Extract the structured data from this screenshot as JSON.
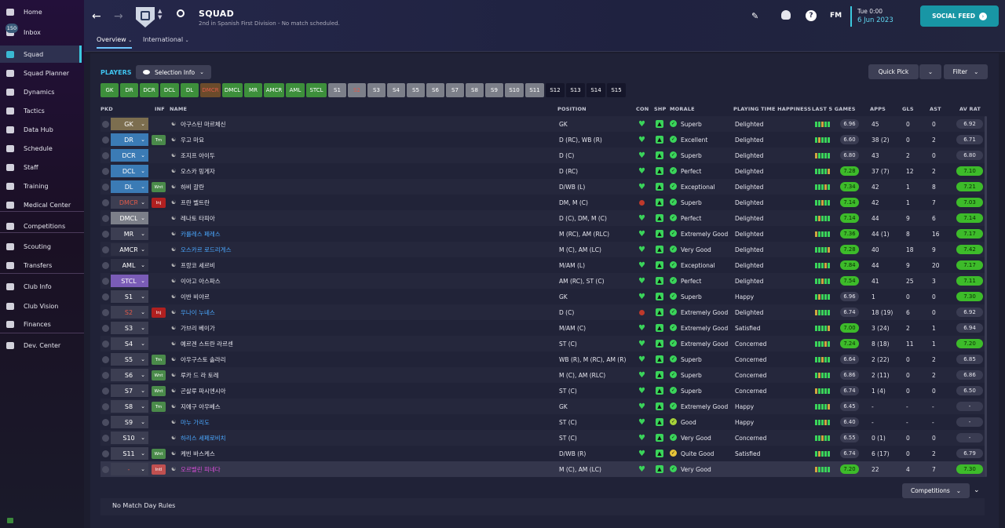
{
  "sidebar": {
    "inbox_badge": "150",
    "items": [
      {
        "label": "Home",
        "icon": "home-icon"
      },
      {
        "label": "Inbox",
        "icon": "inbox-icon"
      },
      {
        "label": "Squad",
        "icon": "shirt-icon"
      },
      {
        "label": "Squad Planner",
        "icon": "clipboard-icon"
      },
      {
        "label": "Dynamics",
        "icon": "dynamics-icon"
      },
      {
        "label": "Tactics",
        "icon": "tactics-icon"
      },
      {
        "label": "Data Hub",
        "icon": "data-hub-icon"
      },
      {
        "label": "Schedule",
        "icon": "calendar-icon"
      },
      {
        "label": "Staff",
        "icon": "staff-icon"
      },
      {
        "label": "Training",
        "icon": "training-icon"
      },
      {
        "label": "Medical Center",
        "icon": "medical-icon"
      },
      {
        "label": "Competitions",
        "icon": "trophy-icon"
      },
      {
        "label": "Scouting",
        "icon": "scouting-icon"
      },
      {
        "label": "Transfers",
        "icon": "transfers-icon"
      },
      {
        "label": "Club Info",
        "icon": "shield-icon"
      },
      {
        "label": "Club Vision",
        "icon": "vision-icon"
      },
      {
        "label": "Finances",
        "icon": "finances-icon"
      },
      {
        "label": "Dev. Center",
        "icon": "dev-center-icon"
      }
    ]
  },
  "header": {
    "title": "SQUAD",
    "subtitle": "2nd in Spanish First Division - No match scheduled.",
    "tabs": [
      "Overview",
      "International"
    ],
    "fm": "FM",
    "time": "Tue 0:00",
    "date": "6 Jun 2023",
    "social_feed": "SOCIAL FEED"
  },
  "players_title": "PLAYERS",
  "selection_info": "Selection Info",
  "quick_pick": "Quick Pick",
  "filter": "Filter",
  "formation_slots": [
    "GK",
    "DR",
    "DCR",
    "DCL",
    "DL",
    "DMCR",
    "DMCL",
    "MR",
    "AMCR",
    "AML",
    "STCL",
    "S1",
    "S2",
    "S3",
    "S4",
    "S5",
    "S6",
    "S7",
    "S8",
    "S9",
    "S10",
    "S11",
    "S12",
    "S13",
    "S14",
    "S15"
  ],
  "columns": {
    "pkd": "PKD",
    "inf": "INF",
    "name": "NAME",
    "position": "POSITION",
    "con": "CON",
    "shp": "SHP",
    "morale": "MORALE",
    "pth": "PLAYING TIME HAPPINESS",
    "last5": "LAST 5 GAMES",
    "apps": "APPS",
    "gls": "GLS",
    "ast": "AST",
    "avrat": "AV RAT"
  },
  "players": [
    {
      "slot": "GK",
      "inf": "",
      "name": "아구스틴 마르체신",
      "pos": "GK",
      "con": "fit",
      "morale": "Superb",
      "pt": "Delighted",
      "l5": "6.96",
      "apps": "45",
      "gls": "0",
      "ast": "0",
      "av": "6.92"
    },
    {
      "slot": "DR",
      "inf": "Trn",
      "name": "우고 마요",
      "pos": "D (RC), WB (R)",
      "con": "fit",
      "morale": "Excellent",
      "pt": "Delighted",
      "l5": "6.60",
      "apps": "38 (2)",
      "gls": "0",
      "ast": "2",
      "av": "6.71"
    },
    {
      "slot": "DCR",
      "inf": "",
      "name": "조지프 아이두",
      "pos": "D (C)",
      "con": "fit",
      "morale": "Superb",
      "pt": "Delighted",
      "l5": "6.80",
      "apps": "43",
      "gls": "2",
      "ast": "0",
      "av": "6.80"
    },
    {
      "slot": "DCL",
      "inf": "",
      "name": "오스카 밍게자",
      "pos": "D (RC)",
      "con": "fit",
      "morale": "Perfect",
      "pt": "Delighted",
      "l5": "7.28",
      "apps": "37 (7)",
      "gls": "12",
      "ast": "2",
      "av": "7.10"
    },
    {
      "slot": "DL",
      "inf": "Wnt",
      "name": "하비 갈란",
      "pos": "D/WB (L)",
      "con": "fit",
      "morale": "Exceptional",
      "pt": "Delighted",
      "l5": "7.34",
      "apps": "42",
      "gls": "1",
      "ast": "8",
      "av": "7.21"
    },
    {
      "slot": "DMCR",
      "inf": "Inj",
      "name": "프란 벨트란",
      "pos": "DM, M (C)",
      "con": "inj",
      "morale": "Superb",
      "pt": "Delighted",
      "l5": "7.14",
      "apps": "42",
      "gls": "1",
      "ast": "7",
      "av": "7.03"
    },
    {
      "slot": "DMCL",
      "inf": "",
      "name": "레나토 타피아",
      "pos": "D (C), DM, M (C)",
      "con": "fit",
      "morale": "Perfect",
      "pt": "Delighted",
      "l5": "7.14",
      "apps": "44",
      "gls": "9",
      "ast": "6",
      "av": "7.14"
    },
    {
      "slot": "MR",
      "inf": "",
      "name": "카를레스 페레스",
      "pos": "M (RC), AM (RLC)",
      "con": "fit",
      "morale": "Extremely Good",
      "pt": "Delighted",
      "l5": "7.36",
      "apps": "44 (1)",
      "gls": "8",
      "ast": "16",
      "av": "7.17"
    },
    {
      "slot": "AMCR",
      "inf": "",
      "name": "오스카르 로드리게스",
      "pos": "M (C), AM (LC)",
      "con": "fit",
      "morale": "Very Good",
      "pt": "Delighted",
      "l5": "7.28",
      "apps": "40",
      "gls": "18",
      "ast": "9",
      "av": "7.42"
    },
    {
      "slot": "AML",
      "inf": "",
      "name": "프랑코 세르비",
      "pos": "M/AM (L)",
      "con": "fit",
      "morale": "Exceptional",
      "pt": "Delighted",
      "l5": "7.84",
      "apps": "44",
      "gls": "9",
      "ast": "20",
      "av": "7.17"
    },
    {
      "slot": "STCL",
      "inf": "",
      "name": "이아고 아스파스",
      "pos": "AM (RC), ST (C)",
      "con": "fit",
      "morale": "Perfect",
      "pt": "Delighted",
      "l5": "7.54",
      "apps": "41",
      "gls": "25",
      "ast": "3",
      "av": "7.11"
    },
    {
      "slot": "S1",
      "inf": "",
      "name": "이반 비야르",
      "pos": "GK",
      "con": "fit",
      "morale": "Superb",
      "pt": "Happy",
      "l5": "6.96",
      "apps": "1",
      "gls": "0",
      "ast": "0",
      "av": "7.30"
    },
    {
      "slot": "S2",
      "inf": "Inj",
      "name": "우나이 누녜스",
      "pos": "D (C)",
      "con": "inj",
      "morale": "Extremely Good",
      "pt": "Delighted",
      "l5": "6.74",
      "apps": "18 (19)",
      "gls": "6",
      "ast": "0",
      "av": "6.92"
    },
    {
      "slot": "S3",
      "inf": "",
      "name": "가브리 베이가",
      "pos": "M/AM (C)",
      "con": "fit",
      "morale": "Extremely Good",
      "pt": "Satisfied",
      "l5": "7.00",
      "apps": "3 (24)",
      "gls": "2",
      "ast": "1",
      "av": "6.94"
    },
    {
      "slot": "S4",
      "inf": "",
      "name": "예르겐 스트란 라르센",
      "pos": "ST (C)",
      "con": "fit",
      "morale": "Extremely Good",
      "pt": "Concerned",
      "l5": "7.24",
      "apps": "8 (18)",
      "gls": "11",
      "ast": "1",
      "av": "7.20"
    },
    {
      "slot": "S5",
      "inf": "Trn",
      "name": "아우구스토 솔라리",
      "pos": "WB (R), M (RC), AM (R)",
      "con": "fit",
      "morale": "Superb",
      "pt": "Concerned",
      "l5": "6.64",
      "apps": "2 (22)",
      "gls": "0",
      "ast": "2",
      "av": "6.85"
    },
    {
      "slot": "S6",
      "inf": "Wnt",
      "name": "루카 드 라 토레",
      "pos": "M (C), AM (RLC)",
      "con": "fit",
      "morale": "Superb",
      "pt": "Concerned",
      "l5": "6.86",
      "apps": "2 (11)",
      "gls": "0",
      "ast": "2",
      "av": "6.86"
    },
    {
      "slot": "S7",
      "inf": "Wnt",
      "name": "곤살루 파시엔시아",
      "pos": "ST (C)",
      "con": "fit",
      "morale": "Superb",
      "pt": "Concerned",
      "l5": "6.74",
      "apps": "1 (4)",
      "gls": "0",
      "ast": "0",
      "av": "6.50"
    },
    {
      "slot": "S8",
      "inf": "Trn",
      "name": "지에구 아우베스",
      "pos": "GK",
      "con": "fit",
      "morale": "Extremely Good",
      "pt": "Happy",
      "l5": "6.45",
      "apps": "-",
      "gls": "-",
      "ast": "-",
      "av": "-"
    },
    {
      "slot": "S9",
      "inf": "",
      "name": "마누 가리도",
      "pos": "ST (C)",
      "con": "fit",
      "morale": "Good",
      "pt": "Happy",
      "l5": "6.40",
      "apps": "-",
      "gls": "-",
      "ast": "-",
      "av": "-"
    },
    {
      "slot": "S10",
      "inf": "",
      "name": "하리스 세페로비치",
      "pos": "ST (C)",
      "con": "fit",
      "morale": "Very Good",
      "pt": "Concerned",
      "l5": "6.55",
      "apps": "0 (1)",
      "gls": "0",
      "ast": "0",
      "av": "-"
    },
    {
      "slot": "S11",
      "inf": "Wnt",
      "name": "케빈 바스케스",
      "pos": "D/WB (R)",
      "con": "fit",
      "morale": "Quite Good",
      "pt": "Satisfied",
      "l5": "6.74",
      "apps": "6 (17)",
      "gls": "0",
      "ast": "2",
      "av": "6.79"
    },
    {
      "slot": "-",
      "inf": "Intl",
      "name": "오르벨린 피네다",
      "pos": "M (C), AM (LC)",
      "con": "fit",
      "morale": "Very Good",
      "pt": "",
      "l5": "7.20",
      "apps": "22",
      "gls": "4",
      "ast": "7",
      "av": "7.30"
    }
  ],
  "footer": {
    "competitions": "Competitions",
    "rules": "No Match Day Rules"
  }
}
